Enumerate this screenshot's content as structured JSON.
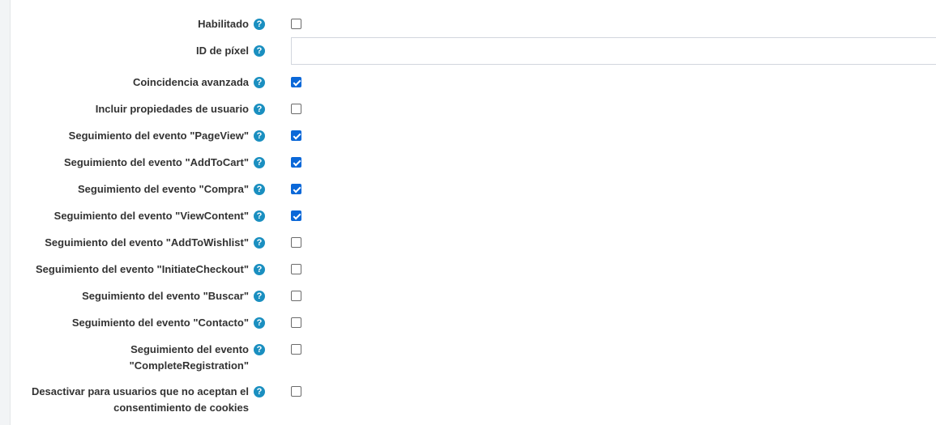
{
  "fields": {
    "habilitado": {
      "label": "Habilitado",
      "checked": false
    },
    "pixel_id": {
      "label": "ID de píxel",
      "value": "",
      "placeholder": ""
    },
    "coincidencia": {
      "label": "Coincidencia avanzada",
      "checked": true
    },
    "propiedades": {
      "label": "Incluir propiedades de usuario",
      "checked": false
    },
    "pageview": {
      "label": "Seguimiento del evento \"PageView\"",
      "checked": true
    },
    "addtocart": {
      "label": "Seguimiento del evento \"AddToCart\"",
      "checked": true
    },
    "compra": {
      "label": "Seguimiento del evento \"Compra\"",
      "checked": true
    },
    "viewcontent": {
      "label": "Seguimiento del evento \"ViewContent\"",
      "checked": true
    },
    "addtowishlist": {
      "label": "Seguimiento del evento \"AddToWishlist\"",
      "checked": false
    },
    "initiatecheckout": {
      "label": "Seguimiento del evento \"InitiateCheckout\"",
      "checked": false
    },
    "buscar": {
      "label": "Seguimiento del evento \"Buscar\"",
      "checked": false
    },
    "contacto": {
      "label": "Seguimiento del evento \"Contacto\"",
      "checked": false
    },
    "completeregistration": {
      "label_line1": "Seguimiento del evento",
      "label_line2": "\"CompleteRegistration\"",
      "checked": false
    },
    "cookies": {
      "label_line1": "Desactivar para usuarios que no aceptan el",
      "label_line2": "consentimiento de cookies",
      "checked": false
    }
  },
  "help_glyph": "?",
  "icons": {
    "help": "question-circle-icon"
  },
  "colors": {
    "help_icon": "#1a8fc0",
    "checkbox_checked": "#0b68d8"
  }
}
